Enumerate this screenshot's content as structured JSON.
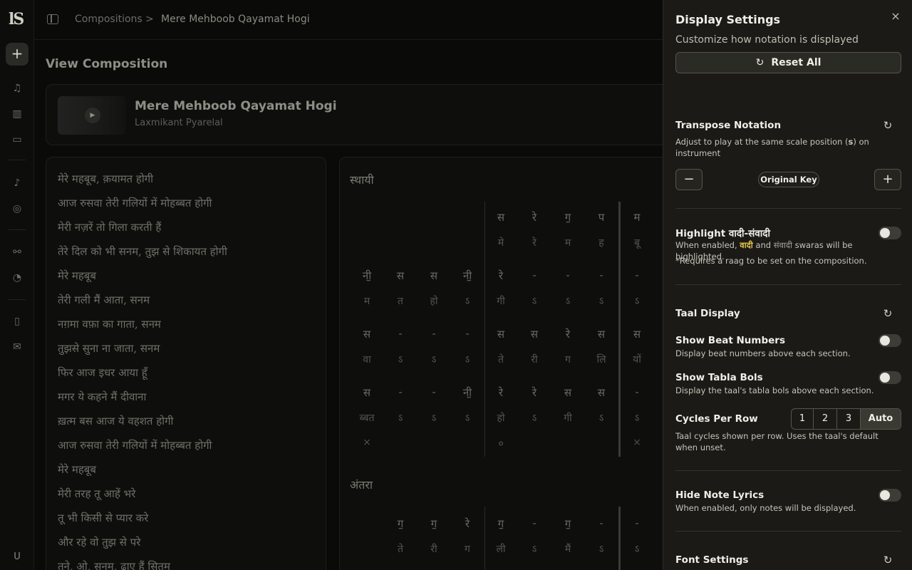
{
  "breadcrumb": {
    "root": "Compositions",
    "separator": ">",
    "current": "Mere Mehboob Qayamat Hogi"
  },
  "rail": {
    "logo": "lS",
    "add": "+",
    "user": "U"
  },
  "main": {
    "title": "View Composition",
    "song": {
      "title": "Mere Mehboob Qayamat Hogi",
      "artist": "Laxmikant Pyarelal"
    },
    "lyrics": [
      "मेरे महबूब, क़यामत होगी",
      "आज रुसवा तेरी गलियों में मोहब्बत होगी",
      "मेरी नज़रें तो गिला करती हैं",
      "तेरे दिल को भी सनम, तुझ से शिकायत होगी",
      "मेरे महबूब",
      "तेरी गली मैं आता, सनम",
      "नग़मा वफ़ा का गाता, सनम",
      "तुझसे सुना ना जाता, सनम",
      "फिर आज इधर आया हूँ",
      "मगर ये कहने मैं दीवाना",
      "ख़त्म बस आज ये वहशत होगी",
      "आज रुसवा तेरी गलियों में मोहब्बत होगी",
      "मेरे महबूब",
      "मेरी तरह तू आहें भरे",
      "तू भी किसी से प्यार करे",
      "और रहे वो तुझ से परे",
      "तूने, ओ, सनम, ढाए हैं सितम"
    ],
    "sthayi": {
      "title": "स्थायी",
      "rows": [
        {
          "notes": [
            "",
            "",
            "",
            "",
            "स",
            "रे",
            "ग॒",
            "प",
            "म"
          ],
          "lyrics": [
            "",
            "",
            "",
            "",
            "मे",
            "रे",
            "म",
            "ह",
            "बू"
          ]
        },
        {
          "notes": [
            "नी॒",
            "स",
            "स",
            "नी॒",
            "रे",
            "-",
            "-",
            "-",
            "-"
          ],
          "lyrics": [
            "म",
            "त",
            "हो",
            "ऽ",
            "गी",
            "ऽ",
            "ऽ",
            "ऽ",
            "ऽ"
          ]
        },
        {
          "notes": [
            "स",
            "-",
            "-",
            "-",
            "स",
            "स",
            "रे",
            "स",
            "स"
          ],
          "lyrics": [
            "वा",
            "ऽ",
            "ऽ",
            "ऽ",
            "ते",
            "री",
            "ग",
            "लि",
            "यों"
          ]
        },
        {
          "notes": [
            "स",
            "-",
            "-",
            "नी॒",
            "रे",
            "रे",
            "स",
            "स",
            "-"
          ],
          "lyrics": [
            "ब्बत",
            "ऽ",
            "ऽ",
            "ऽ",
            "हो",
            "ऽ",
            "गी",
            "ऽ",
            "ऽ"
          ]
        }
      ],
      "markers": [
        "×",
        "",
        "",
        "",
        "०",
        "",
        "",
        "",
        "×"
      ]
    },
    "antara": {
      "title": "अंतरा",
      "rows": [
        {
          "notes": [
            "",
            "ग॒",
            "ग॒",
            "रे",
            "ग॒",
            "-",
            "ग॒",
            "-",
            "-"
          ],
          "lyrics": [
            "",
            "ते",
            "री",
            "ग",
            "ली",
            "ऽ",
            "मैं",
            "ऽ",
            "ऽ"
          ]
        }
      ]
    }
  },
  "panel": {
    "title": "Display Settings",
    "close": "×",
    "subtitle": "Customize how notation is displayed",
    "reset_all": "Reset All",
    "transpose": {
      "title": "Transpose Notation",
      "desc_pre": "Adjust to play at the same scale position (",
      "desc_key": "s",
      "desc_post": ") on instrument",
      "minus": "−",
      "plus": "+",
      "value": "Original Key"
    },
    "highlight": {
      "title": "Highlight वादी-संवादी",
      "desc_pre": "When enabled, ",
      "vadi": "वादी",
      "desc_mid": " and ",
      "samvadi": "संवादी",
      "desc_post": " swaras will be highlighted.",
      "note": "*Requires a raag to be set on the composition.",
      "enabled": false
    },
    "taal": {
      "title": "Taal Display",
      "beat_numbers": {
        "title": "Show Beat Numbers",
        "desc": "Display beat numbers above each section.",
        "enabled": false
      },
      "tabla_bols": {
        "title": "Show Tabla Bols",
        "desc": "Display the taal's tabla bols above each section.",
        "enabled": false
      },
      "cycles": {
        "title": "Cycles Per Row",
        "options": [
          "1",
          "2",
          "3",
          "Auto"
        ],
        "selected": "Auto",
        "desc": "Taal cycles shown per row. Uses the taal's default when unset."
      }
    },
    "hide_lyrics": {
      "title": "Hide Note Lyrics",
      "desc": "When enabled, only notes will be displayed.",
      "enabled": false
    },
    "font": {
      "title": "Font Settings"
    }
  },
  "icons": {
    "reset": "↻",
    "close": "×"
  }
}
